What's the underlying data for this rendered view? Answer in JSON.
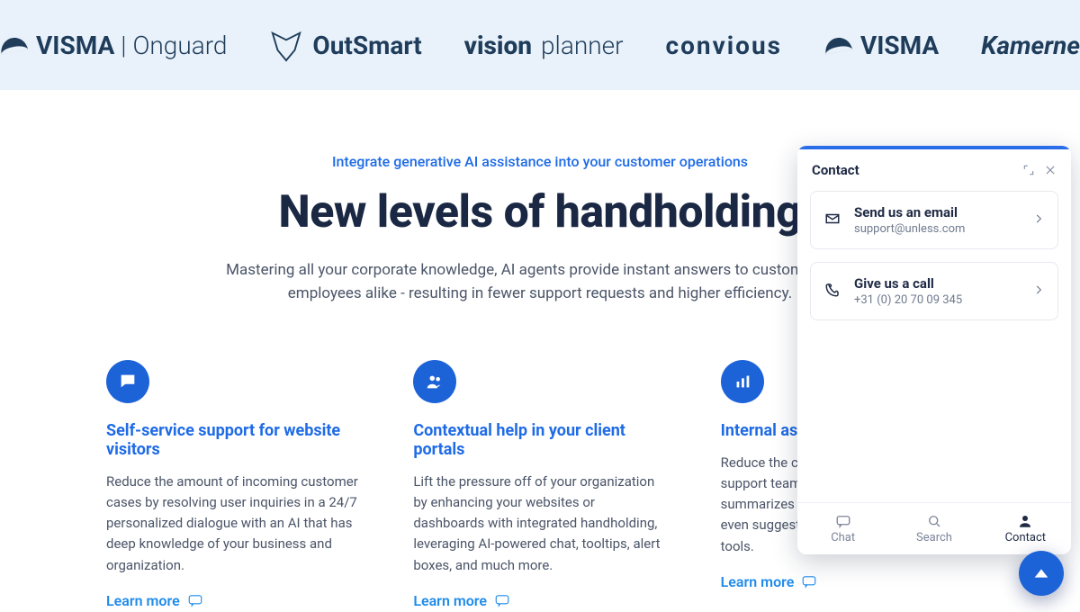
{
  "logos": [
    {
      "name": "VISMA | Onguard"
    },
    {
      "name": "OutSmart"
    },
    {
      "name": "visionplanner"
    },
    {
      "name": "convious"
    },
    {
      "name": "VISMA"
    },
    {
      "name": "Kamerne"
    }
  ],
  "hero": {
    "kicker": "Integrate generative AI assistance into your customer operations",
    "title": "New levels of handholding",
    "subtitle": "Mastering all your corporate knowledge, AI agents provide instant answers to customers and employees alike - resulting in fewer support requests and higher efficiency."
  },
  "features": [
    {
      "title": "Self-service support for website visitors",
      "body": "Reduce the amount of incoming customer cases by resolving user inquiries in a 24/7 personalized dialogue with an AI that has deep knowledge of your business and organization.",
      "cta": "Learn more"
    },
    {
      "title": "Contextual help in your client portals",
      "body": "Lift the pressure off of your organization by enhancing your websites or dashboards with integrated handholding, leveraging AI-powered chat, tooltips, alert boxes, and much more.",
      "cta": "Learn more"
    },
    {
      "title": "Internal assistance",
      "body": "Reduce the case resolution time of your support team with an AI agent that summarizes complex information and even suggests replies in their favorite tools.",
      "cta": "Learn more"
    }
  ],
  "widget": {
    "title": "Contact",
    "cards": [
      {
        "title": "Send us an email",
        "subtitle": "support@unless.com"
      },
      {
        "title": "Give us a call",
        "subtitle": "+31 (0) 20 70 09 345"
      }
    ],
    "tabs": [
      {
        "label": "Chat"
      },
      {
        "label": "Search"
      },
      {
        "label": "Contact"
      }
    ],
    "active_tab": "Contact"
  }
}
